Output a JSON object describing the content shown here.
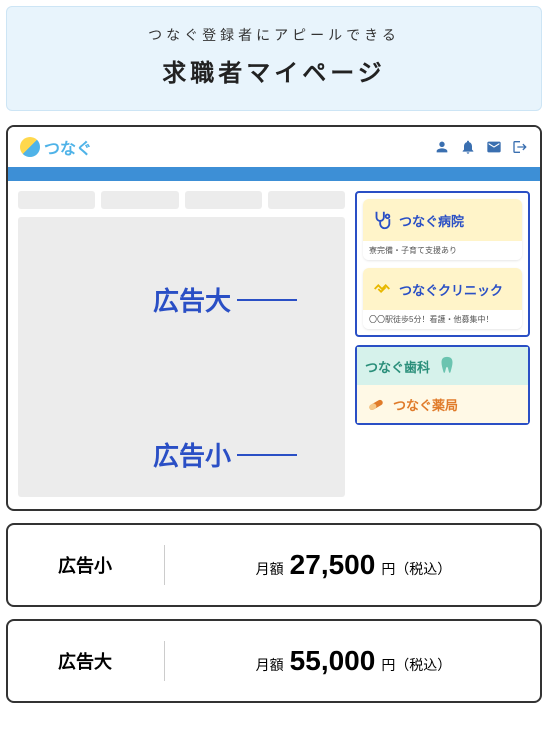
{
  "hero": {
    "sub": "つなぐ登録者にアピールできる",
    "title": "求職者マイページ"
  },
  "logo": {
    "text": "つなぐ"
  },
  "ads_large": [
    {
      "title": "つなぐ病院",
      "caption": "寮完備・子育て支援あり",
      "bg": "yellow",
      "icon": "stethoscope",
      "titleColor": "blue"
    },
    {
      "title": "つなぐクリニック",
      "caption": "〇〇駅徒歩5分！看護・他募集中！",
      "bg": "yellow",
      "icon": "handshake",
      "titleColor": "blue"
    }
  ],
  "ads_small": [
    {
      "title": "つなぐ歯科",
      "bg": "mint",
      "icon": "tooth",
      "titleColor": "teal"
    },
    {
      "title": "つなぐ薬局",
      "bg": "cream",
      "icon": "pill",
      "titleColor": "orange"
    }
  ],
  "callouts": {
    "large": "広告大",
    "small": "広告小"
  },
  "pricing": [
    {
      "label": "広告小",
      "prefix": "月額",
      "amount": "27,500",
      "suffix": "円（税込）"
    },
    {
      "label": "広告大",
      "prefix": "月額",
      "amount": "55,000",
      "suffix": "円（税込）"
    }
  ]
}
